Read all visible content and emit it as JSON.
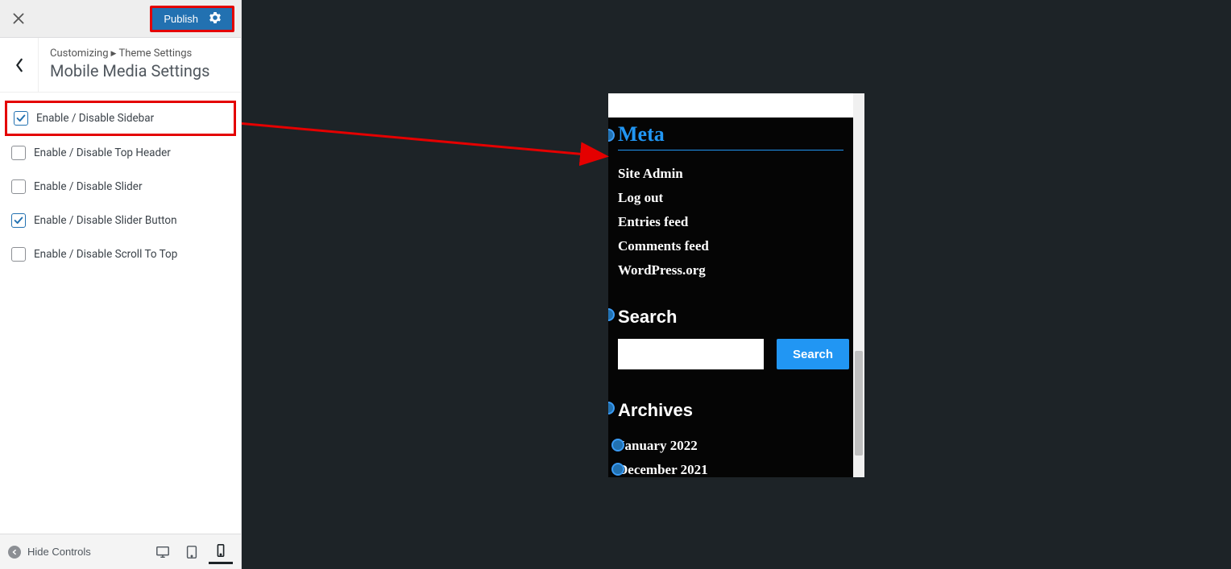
{
  "header": {
    "publish_label": "Publish"
  },
  "breadcrumb": {
    "customizing": "Customizing",
    "parent": "Theme Settings",
    "title": "Mobile Media Settings"
  },
  "options": [
    {
      "label": "Enable / Disable Sidebar",
      "checked": true,
      "highlighted": true
    },
    {
      "label": "Enable / Disable Top Header",
      "checked": false,
      "highlighted": false
    },
    {
      "label": "Enable / Disable Slider",
      "checked": false,
      "highlighted": false
    },
    {
      "label": "Enable / Disable Slider Button",
      "checked": true,
      "highlighted": false
    },
    {
      "label": "Enable / Disable Scroll To Top",
      "checked": false,
      "highlighted": false
    }
  ],
  "footer": {
    "hide_label": "Hide Controls"
  },
  "preview": {
    "meta_title": "Meta",
    "meta_items": [
      "Site Admin",
      "Log out",
      "Entries feed",
      "Comments feed",
      "WordPress.org"
    ],
    "search_title": "Search",
    "search_button": "Search",
    "archives_title": "Archives",
    "archive_items": [
      "January 2022",
      "December 2021"
    ]
  },
  "colors": {
    "annotation": "#e40000",
    "primary": "#2271b1",
    "accent": "#2196f3",
    "dark": "#1d2327"
  }
}
